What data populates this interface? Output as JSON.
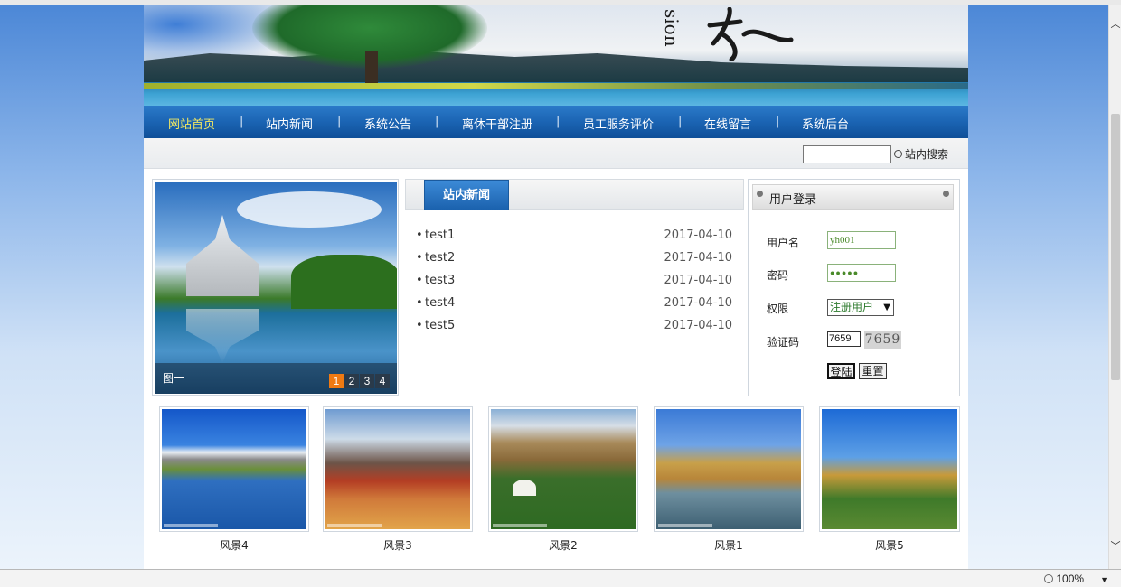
{
  "banner": {
    "word": "sion"
  },
  "nav": {
    "items": [
      {
        "label": "网站首页",
        "active": true
      },
      {
        "label": "站内新闻",
        "active": false
      },
      {
        "label": "系统公告",
        "active": false
      },
      {
        "label": "离休干部注册",
        "active": false
      },
      {
        "label": "员工服务评价",
        "active": false
      },
      {
        "label": "在线留言",
        "active": false
      },
      {
        "label": "系统后台",
        "active": false
      }
    ],
    "separator": "|"
  },
  "search": {
    "input_value": "",
    "button_label": "站内搜索"
  },
  "slideshow": {
    "caption": "图一",
    "pages": [
      "1",
      "2",
      "3",
      "4"
    ],
    "active_page": "1"
  },
  "news": {
    "tab_label": "站内新闻",
    "bullet": "•",
    "items": [
      {
        "title": "test1",
        "date": "2017-04-10"
      },
      {
        "title": "test2",
        "date": "2017-04-10"
      },
      {
        "title": "test3",
        "date": "2017-04-10"
      },
      {
        "title": "test4",
        "date": "2017-04-10"
      },
      {
        "title": "test5",
        "date": "2017-04-10"
      }
    ]
  },
  "login": {
    "title": "用户登录",
    "username_label": "用户名",
    "username_value": "yh001",
    "password_label": "密码",
    "password_value": "●●●●●",
    "role_label": "权限",
    "role_value": "注册用户",
    "captcha_label": "验证码",
    "captcha_input": "7659",
    "captcha_image_text": "7659",
    "login_button": "登陆",
    "reset_button": "重置"
  },
  "gallery": [
    {
      "caption": "风景4"
    },
    {
      "caption": "风景3"
    },
    {
      "caption": "风景2"
    },
    {
      "caption": "风景1"
    },
    {
      "caption": "风景5"
    }
  ],
  "statusbar": {
    "zoom": "100%"
  }
}
